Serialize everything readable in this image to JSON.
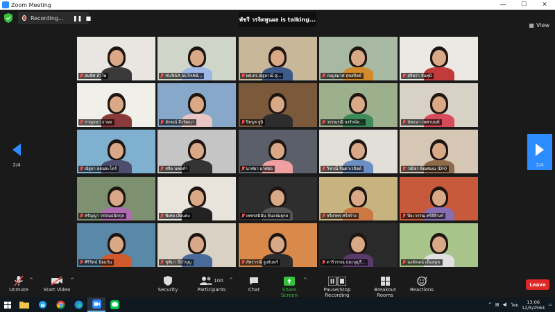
{
  "window": {
    "title": "Zoom Meeting",
    "minimize": "—",
    "maximize": "☐",
    "close": "✕"
  },
  "recording": {
    "label": "Recording..."
  },
  "talking": {
    "text": "พัชรี วรจิตพูนผล is talking..."
  },
  "view": {
    "label": "View"
  },
  "page": {
    "left": "2/4",
    "right": "2/4"
  },
  "participants_grid": [
    {
      "name": "สมพิศ ฮำไพ",
      "bg": "#e9e6e1",
      "shirt": "#3a3a3a"
    },
    {
      "name": "HUNSA SETHAB...",
      "bg": "#cfd6c9",
      "shirt": "#9db7e6"
    },
    {
      "name": "ผศ.ดร.ณัฐยาณี สุ...",
      "bg": "#c9b79a",
      "shirt": "#3d5a8a"
    },
    {
      "name": "เบญจมาศ สุขสถิตย์",
      "bg": "#a7b8a3",
      "shirt": "#d28a2c"
    },
    {
      "name": "สุจิตรา จันทุมิ",
      "bg": "#ece9e4",
      "shirt": "#c23b3b"
    },
    {
      "name": "กาญจนา ธาษย",
      "bg": "#f1efea",
      "shirt": "#8a3a3a"
    },
    {
      "name": "ลักขณ์ อึ่งวัฒนา",
      "bg": "#87a8c9",
      "shirt": "#e9c6c6"
    },
    {
      "name": "ปิยนุช ฐูนิ",
      "bg": "#7b5a3c",
      "shirt": "#2d2d2d"
    },
    {
      "name": "วรรณรณี จงรักษ์ล...",
      "bg": "#9cb08d",
      "shirt": "#3d8a5a"
    },
    {
      "name": "นัทธนา เทศานนท์",
      "bg": "#d8d2c6",
      "shirt": "#d84b5a"
    },
    {
      "name": "ณัฐยา ออนสะโตร์",
      "bg": "#7fb0cf",
      "shirt": "#4d4d6d"
    },
    {
      "name": "สลิล นพลคำ",
      "bg": "#c5c5c5",
      "shirt": "#333333"
    },
    {
      "name": "นาศยา มาศอ่อ",
      "bg": "#5a5f69",
      "shirt": "#f0a0a0"
    },
    {
      "name": "วิชาณี จินดาเวนิชย์",
      "bg": "#e1dfd8",
      "shirt": "#6b8fc0"
    },
    {
      "name": "วณิชา พิณศมณ (DH)",
      "bg": "#d6c6b4",
      "shirt": "#8c6a4a"
    },
    {
      "name": "ศรัญญา วรรณธนักกุล",
      "bg": "#7d9070",
      "shirt": "#b06ab0"
    },
    {
      "name": "พิเศษ เงือนคง",
      "bg": "#e8e4dc",
      "shirt": "#222222"
    },
    {
      "name": "เพชรสมิมิน จันแจ่มยุกล",
      "bg": "#2e2e2e",
      "shirt": "#555555"
    },
    {
      "name": "จริยาพร ศรีสร้าง",
      "bg": "#c7b37f",
      "shirt": "#cc7744"
    },
    {
      "name": "ปิยะวรรณ ศรีสิลิวงก์",
      "bg": "#c65a3a",
      "shirt": "#8a6db0"
    },
    {
      "name": "ศิริรัตน์ นิยมวัน",
      "bg": "#5a88a8",
      "shirt": "#d05a2c"
    },
    {
      "name": "ชุติมา มีนำบุญ",
      "bg": "#d9d1c4",
      "shirt": "#4a6a9a"
    },
    {
      "name": "ภัทรารณี ฐงจันทร์",
      "bg": "#d98a4a",
      "shirt": "#2d2d2d"
    },
    {
      "name": "ดาริวรรณ ธยะบุญรี...",
      "bg": "#2a2a2a",
      "shirt": "#5a3a6a"
    },
    {
      "name": "นงลักษณ์ เต็มสมุข",
      "bg": "#a8c48a",
      "shirt": "#e0e0e0"
    }
  ],
  "toolbar": {
    "unmute": "Unmute",
    "start_video": "Start Video",
    "security": "Security",
    "participants": "Participants",
    "participants_count": "100",
    "chat": "Chat",
    "share_screen": "Share Screen",
    "pause_recording": "Pause/Stop Recording",
    "breakout_rooms": "Breakout Rooms",
    "reactions": "Reactions",
    "leave": "Leave"
  },
  "taskbar": {
    "language": "ไทย",
    "time": "13:06",
    "date": "12/5/2564"
  },
  "colors": {
    "accent": "#2d8cff",
    "leave": "#e02828",
    "share": "#36c13b",
    "talking_outline": "#7ddc3c"
  }
}
